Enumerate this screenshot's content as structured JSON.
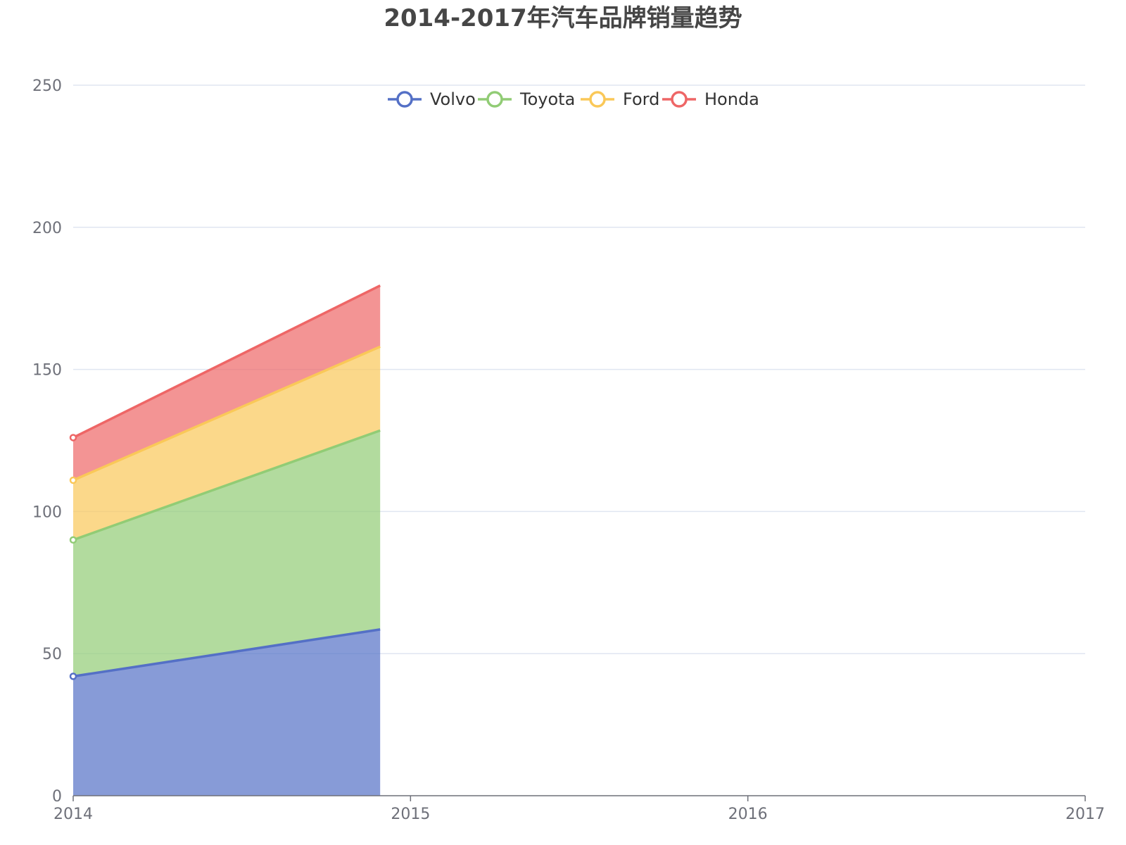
{
  "chart_data": {
    "type": "area",
    "stacked": true,
    "title": "2014-2017年汽车品牌销量趋势",
    "x": [
      "2014",
      "2015",
      "2016",
      "2017"
    ],
    "ylim": [
      0,
      250
    ],
    "yticks": [
      0,
      50,
      100,
      150,
      200,
      250
    ],
    "grid": true,
    "legend_position": "top-center",
    "series": [
      {
        "name": "Volvo",
        "color": "#5470c6",
        "values": [
          42,
          58.5
        ]
      },
      {
        "name": "Toyota",
        "color": "#91cc75",
        "values": [
          48,
          70
        ]
      },
      {
        "name": "Ford",
        "color": "#fac858",
        "values": [
          21,
          29.5
        ]
      },
      {
        "name": "Honda",
        "color": "#ee6666",
        "values": [
          15,
          21.5
        ]
      }
    ],
    "data_x": [
      2014,
      2014.91
    ]
  }
}
